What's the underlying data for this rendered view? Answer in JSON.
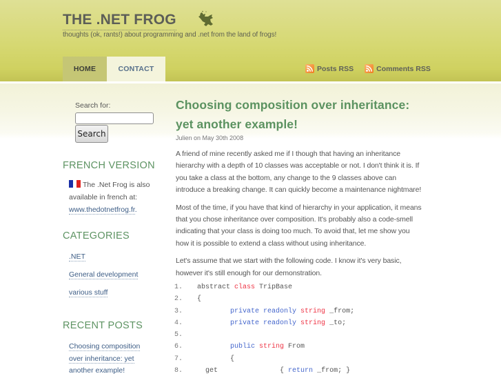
{
  "header": {
    "site_title": "THE .NET FROG",
    "tagline": "thoughts (ok, rants!) about programming and .net from the land of frogs!",
    "logo_icon": "frog-icon"
  },
  "nav": {
    "tabs": [
      {
        "label": "HOME",
        "active": true
      },
      {
        "label": "CONTACT",
        "active": false
      }
    ]
  },
  "rss": {
    "posts_label": "Posts RSS",
    "comments_label": "Comments RSS",
    "icon": "rss-icon"
  },
  "sidebar": {
    "search": {
      "label": "Search for:",
      "value": "",
      "button_label": "Search"
    },
    "french_version": {
      "title": "FRENCH VERSION",
      "text_line1": "The .Net Frog is also",
      "text_line2": "available in french at:",
      "link": "www.thedotnetfrog.fr",
      "link_suffix": "."
    },
    "categories": {
      "title": "CATEGORIES",
      "items": [
        ".NET",
        "General development",
        "various stuff"
      ]
    },
    "recent_posts": {
      "title": "RECENT POSTS",
      "items": [
        {
          "lines": [
            "Choosing composition",
            "over inheritance: yet",
            "another example!"
          ]
        }
      ]
    }
  },
  "post": {
    "title_line1": "Choosing composition over inheritance:",
    "title_line2": "yet another example!",
    "meta": "Julien on May 30th 2008",
    "paragraphs": [
      "A friend of mine recently asked me if I though that having an inheritance hierarchy with a depth of 10 classes was acceptable or not. I don't think it is. If you take a class at the bottom, any change to the 9 classes above can introduce a breaking change. It can quickly become a maintenance nightmare!",
      "Most of the time, if you have that kind of hierarchy in your application, it means that you chose inheritance over composition. It's probably also a code-smell indicating that your class is doing too much. To avoid that, let me show you how it is possible to extend a class without using inheritance.",
      "Let's assume that we start with the following code. I know it's very basic, however it's still enough for our demonstration."
    ],
    "code": [
      {
        "num": "1.",
        "indent": "",
        "tokens": [
          {
            "t": "abstract ",
            "c": ""
          },
          {
            "t": "class",
            "c": "red"
          },
          {
            "t": " TripBase",
            "c": ""
          }
        ]
      },
      {
        "num": "2.",
        "indent": "",
        "tokens": [
          {
            "t": "{",
            "c": ""
          }
        ]
      },
      {
        "num": "3.",
        "indent": "        ",
        "tokens": [
          {
            "t": "private readonly ",
            "c": "blue"
          },
          {
            "t": "string",
            "c": "red"
          },
          {
            "t": " _from;",
            "c": ""
          }
        ]
      },
      {
        "num": "4.",
        "indent": "        ",
        "tokens": [
          {
            "t": "private readonly ",
            "c": "blue"
          },
          {
            "t": "string",
            "c": "red"
          },
          {
            "t": " _to;",
            "c": ""
          }
        ]
      },
      {
        "num": "5.",
        "indent": "",
        "tokens": []
      },
      {
        "num": "6.",
        "indent": "        ",
        "tokens": [
          {
            "t": "public ",
            "c": "blue"
          },
          {
            "t": "string",
            "c": "red"
          },
          {
            "t": " From",
            "c": ""
          }
        ]
      },
      {
        "num": "7.",
        "indent": "        ",
        "tokens": [
          {
            "t": "{",
            "c": ""
          }
        ]
      },
      {
        "num": "8.",
        "indent": "  ",
        "tokens": [
          {
            "t": "get               { ",
            "c": ""
          },
          {
            "t": "return",
            "c": "blue"
          },
          {
            "t": " _from; }",
            "c": ""
          }
        ]
      }
    ]
  },
  "colors": {
    "header_green": "#d6d872",
    "title_green": "#5b9260",
    "link_blue": "#3c5c85",
    "keyword_red": "#ee3344",
    "keyword_blue": "#4466cc"
  }
}
